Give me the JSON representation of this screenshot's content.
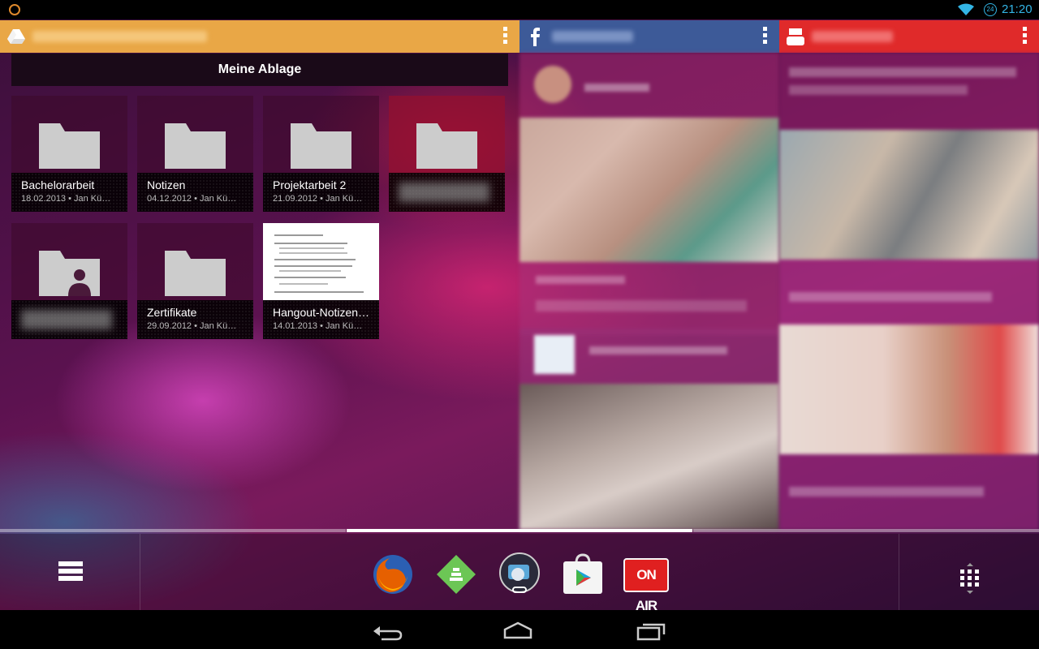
{
  "status_bar": {
    "alarm_badge": "24",
    "time": "21:20"
  },
  "drive": {
    "title": "Meine Ablage",
    "items": [
      {
        "name": "Bachelorarbeit",
        "meta": "18.02.2013 • Jan Kü…",
        "type": "folder"
      },
      {
        "name": "Notizen",
        "meta": "04.12.2012 • Jan Kü…",
        "type": "folder"
      },
      {
        "name": "Projektarbeit 2",
        "meta": "21.09.2012 • Jan Kü…",
        "type": "folder"
      },
      {
        "name": "",
        "meta": "",
        "type": "folder"
      },
      {
        "name": "",
        "meta": "",
        "type": "shared-folder"
      },
      {
        "name": "Zertifikate",
        "meta": "29.09.2012 • Jan Kü…",
        "type": "folder"
      },
      {
        "name": "Hangout-Notizen…",
        "meta": "14.01.2013 • Jan Kü…",
        "type": "document"
      }
    ]
  },
  "dock": {
    "apps": [
      {
        "icon": "firefox-icon"
      },
      {
        "icon": "feedly-icon"
      },
      {
        "icon": "link-bubble-icon"
      },
      {
        "icon": "play-store-icon"
      },
      {
        "icon": "on-air-icon",
        "label": "ON AIR"
      }
    ]
  },
  "colors": {
    "drive_header": "#e9a746",
    "facebook_header": "#3d5a98",
    "youtube_header": "#e02a2a",
    "status_accent": "#33b5e5"
  }
}
